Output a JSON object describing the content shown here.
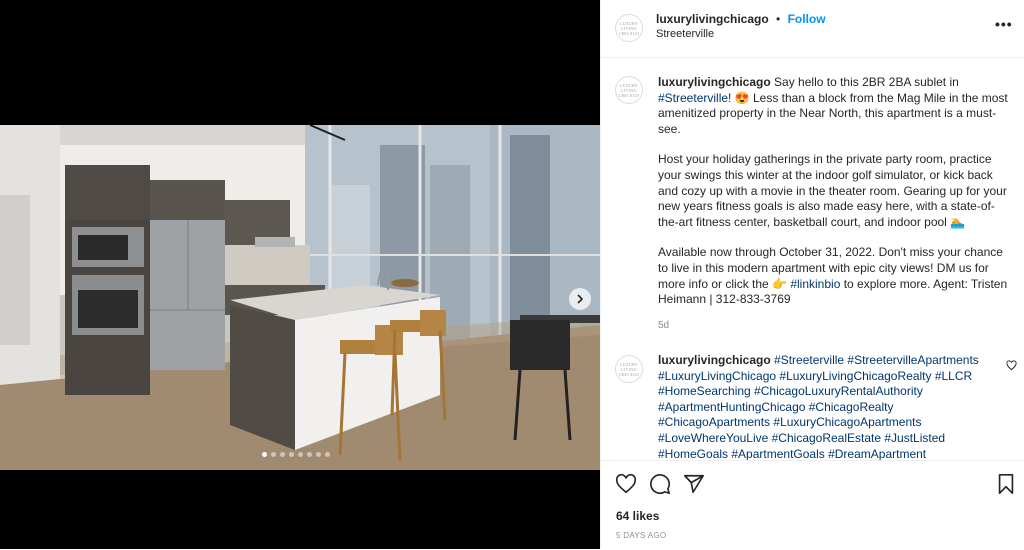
{
  "post": {
    "username": "luxurylivingchicago",
    "follow_label": "Follow",
    "location": "Streeterville",
    "avatar_text": "LUXURY LIVING CHICAGO",
    "more_label": "•••"
  },
  "caption": {
    "username": "luxurylivingchicago",
    "p1_a": " Say hello to this 2BR 2BA sublet in ",
    "p1_tag": "#Streeterville",
    "p1_b": "! 😍 Less than a block from the Mag Mile in the most amenitized property in the Near North, this apartment is a must-see.",
    "p2": "Host your holiday gatherings in the private party room, practice your swings this winter at the indoor golf simulator, or kick back and cozy up with a movie in the theater room. Gearing up for your new years fitness goals is also made easy here, with a state-of-the-art fitness center, basketball court, and indoor pool 🏊",
    "p3_a": "Available now through October 31, 2022. Don't miss your chance to live in this modern apartment with epic city views! DM us for more info or click the 👉 ",
    "p3_tag": "#linkinbio",
    "p3_b": " to explore more. Agent: Tristen Heimann | 312-833-3769",
    "time": "5d"
  },
  "comment": {
    "username": "luxurylivingchicago",
    "text": " #Streeterville #StreetervilleApartments #LuxuryLivingChicago #LuxuryLivingChicagoRealty #LLCR #HomeSearching #ChicagoLuxuryRentalAuthority #ApartmentHuntingChicago #ChicagoRealty #ChicagoApartments #LuxuryChicagoApartments #LoveWhereYouLive #ChicagoRealEstate #JustListed #HomeGoals #ApartmentGoals #DreamApartment"
  },
  "footer": {
    "likes": "64 likes",
    "posted": "5 DAYS AGO"
  },
  "carousel": {
    "count": 8,
    "active_index": 0
  },
  "colors": {
    "link": "#00376b",
    "follow": "#0095f6",
    "muted": "#8e8e8e"
  },
  "icons": [
    "heart-icon",
    "comment-icon",
    "share-icon",
    "bookmark-icon",
    "chevron-right-icon",
    "more-icon"
  ]
}
